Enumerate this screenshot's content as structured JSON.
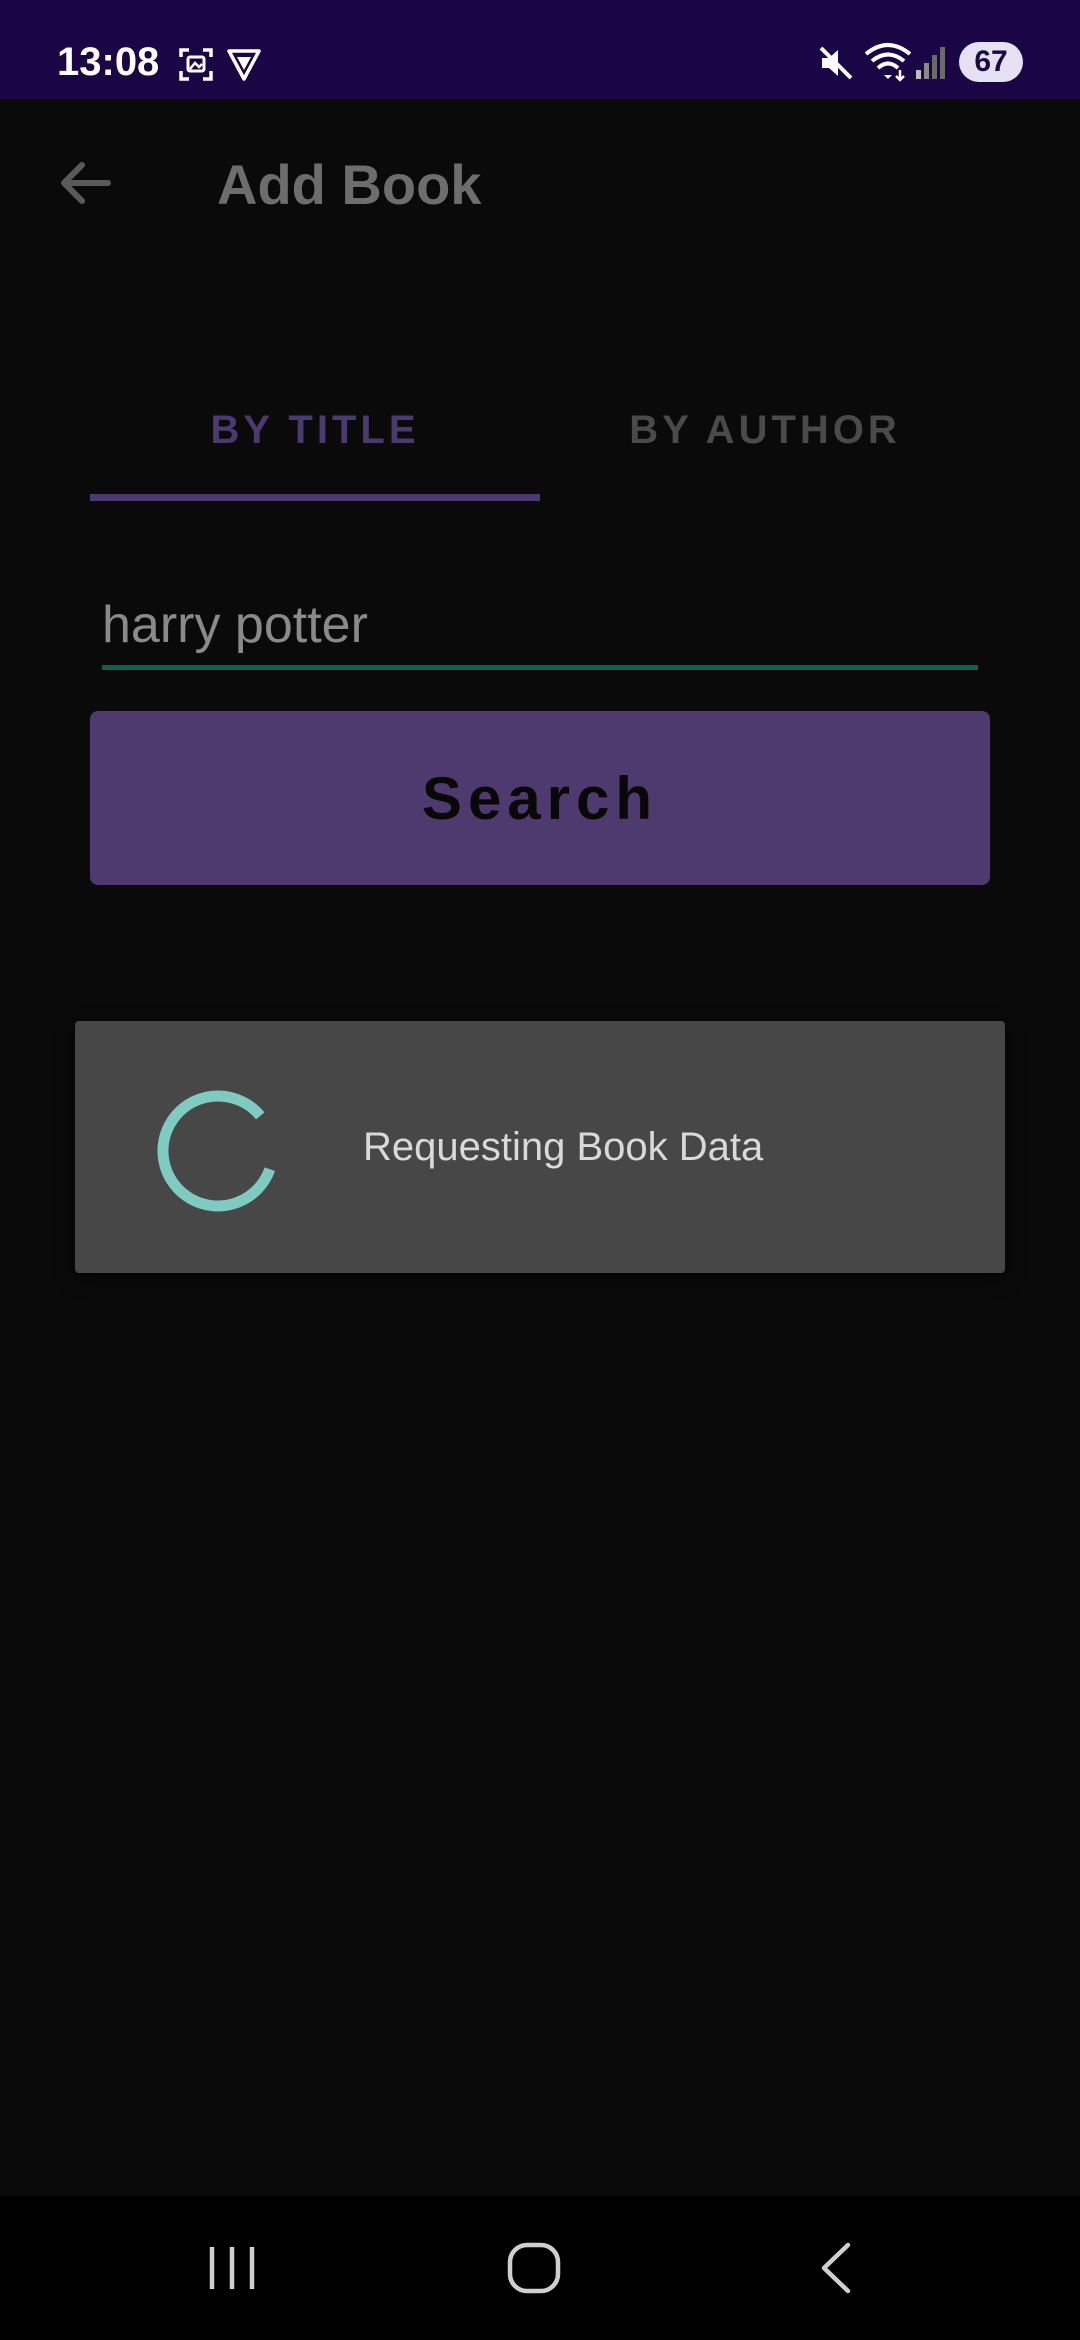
{
  "status_bar": {
    "time": "13:08",
    "battery": "67",
    "icons": [
      "screenshot-icon",
      "vpn-shield-icon",
      "mute-icon",
      "wifi-icon",
      "signal-icon",
      "battery-icon"
    ]
  },
  "app_bar": {
    "title": "Add Book",
    "back_icon": "back-arrow-icon"
  },
  "tabs": [
    {
      "label": "BY TITLE",
      "selected": true
    },
    {
      "label": "BY AUTHOR",
      "selected": false
    }
  ],
  "search": {
    "value": "harry potter",
    "button_label": "Search"
  },
  "loading_dialog": {
    "message": "Requesting Book Data"
  },
  "nav_bar": {
    "items": [
      "recent-apps-icon",
      "home-icon",
      "back-icon"
    ]
  },
  "colors": {
    "status_bar_bg": "#1a0545",
    "accent_purple": "#4e3a6e",
    "spinner_teal": "#7fcbc2",
    "input_underline": "#0c6054"
  }
}
